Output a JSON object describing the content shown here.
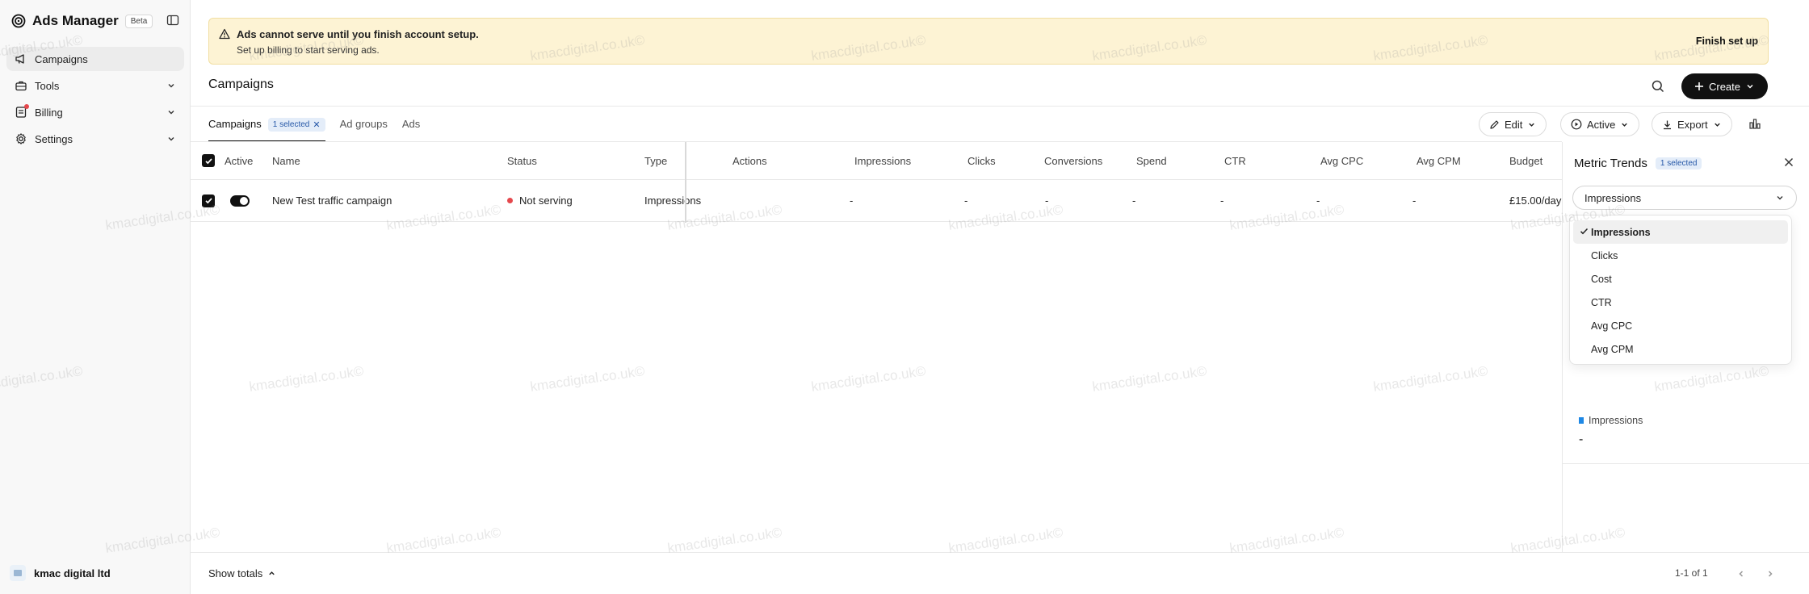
{
  "app": {
    "title": "Ads Manager",
    "badge": "Beta"
  },
  "sidebar": {
    "items": [
      {
        "label": "Campaigns",
        "icon": "megaphone-icon",
        "active": true
      },
      {
        "label": "Tools",
        "icon": "briefcase-icon"
      },
      {
        "label": "Billing",
        "icon": "billing-icon"
      },
      {
        "label": "Settings",
        "icon": "gear-icon"
      }
    ],
    "account": "kmac digital ltd"
  },
  "banner": {
    "title": "Ads cannot serve until you finish account setup.",
    "subtitle": "Set up billing to start serving ads.",
    "action": "Finish set up",
    "color": "#fdf3d4"
  },
  "page": {
    "title": "Campaigns",
    "create_label": "Create"
  },
  "tabs": [
    {
      "label": "Campaigns",
      "badge": "1 selected"
    },
    {
      "label": "Ad groups"
    },
    {
      "label": "Ads"
    }
  ],
  "toolbar": {
    "edit": "Edit",
    "active": "Active",
    "export": "Export"
  },
  "table": {
    "columns": [
      "Active",
      "Name",
      "Status",
      "Type",
      "Actions",
      "Impressions",
      "Clicks",
      "Conversions",
      "Spend",
      "CTR",
      "Avg CPC",
      "Avg CPM",
      "Budget"
    ],
    "rows": [
      {
        "name": "New Test traffic campaign",
        "status": "Not serving",
        "type": "Impressions",
        "actions": "",
        "impressions": "-",
        "clicks": "-",
        "conversions": "-",
        "spend": "-",
        "ctr": "-",
        "avg_cpc": "-",
        "avg_cpm": "-",
        "budget": "£15.00/day"
      }
    ]
  },
  "footer": {
    "show_totals": "Show totals",
    "pagination": "1-1 of 1"
  },
  "panel": {
    "title": "Metric Trends",
    "badge": "1 selected",
    "selected_metric": "Impressions",
    "options": [
      "Impressions",
      "Clicks",
      "Cost",
      "CTR",
      "Avg CPC",
      "Avg CPM"
    ],
    "legend_label": "Impressions",
    "legend_value": "-",
    "legend_color": "#1e88e5"
  },
  "watermark": "kmacdigital.co.uk©"
}
